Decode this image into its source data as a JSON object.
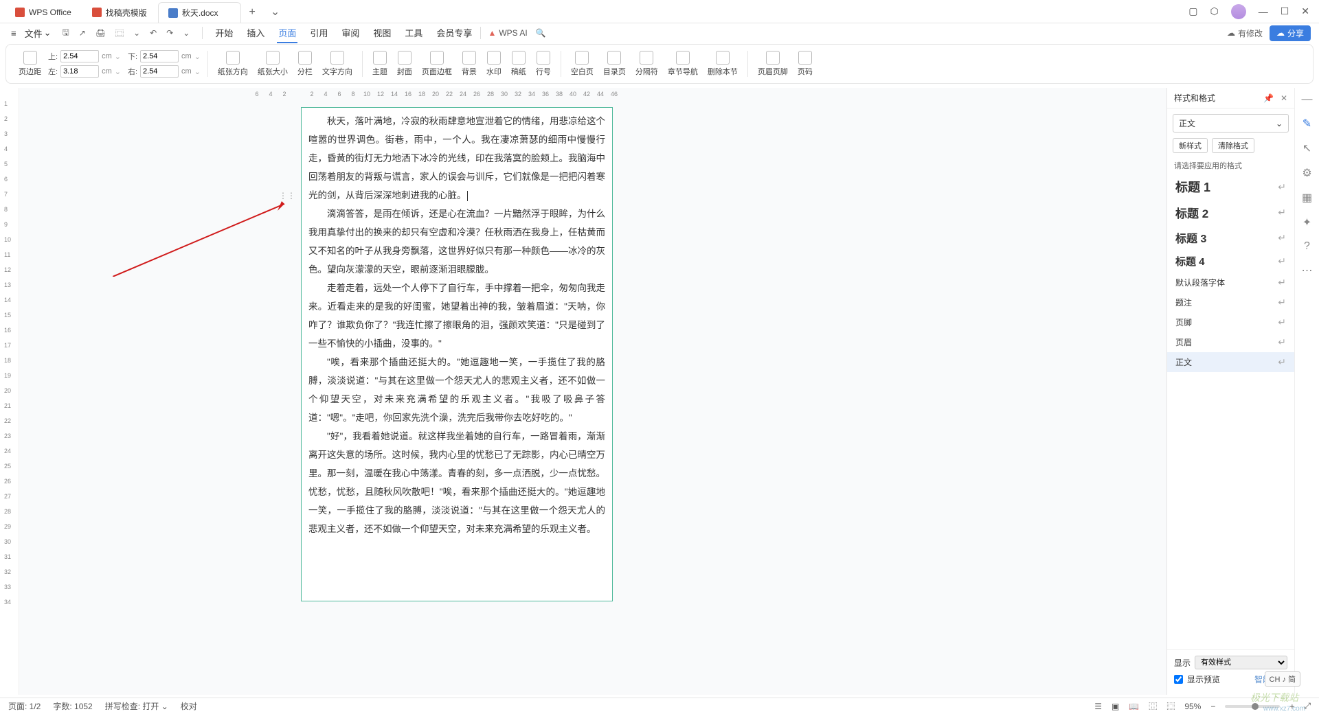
{
  "titlebar": {
    "homeTab": "WPS Office",
    "templateTab": "找稿壳模版",
    "docTab": "秋天.docx",
    "addTab": "+",
    "dropdown": "⌄"
  },
  "wincontrols": {
    "restore": "▢",
    "cube": "⬡",
    "min": "—",
    "max": "☐",
    "close": "✕"
  },
  "menubar": {
    "hamburger": "≡",
    "file": "文件",
    "filedrop": "⌄",
    "menus": [
      "开始",
      "插入",
      "页面",
      "引用",
      "审阅",
      "视图",
      "工具",
      "会员专享"
    ],
    "active": 2,
    "wpsai": "WPS AI",
    "search": "🔍",
    "modified": "有修改",
    "share": "分享"
  },
  "qat": {
    "save": "🖫",
    "export": "↗",
    "print": "🖨",
    "preview": "⿴",
    "undo": "↶",
    "redo": "↷",
    "dd": "⌄"
  },
  "ribbon": {
    "margin": "页边距",
    "top": "上:",
    "topv": "2.54",
    "topu": "cm",
    "bottom": "下:",
    "bottomv": "2.54",
    "bottomu": "cm",
    "left": "左:",
    "leftv": "3.18",
    "leftu": "cm",
    "right": "右:",
    "rightv": "2.54",
    "rightu": "cm",
    "orient": "纸张方向",
    "size": "纸张大小",
    "columns": "分栏",
    "textdir": "文字方向",
    "theme": "主题",
    "cover": "封面",
    "border": "页面边框",
    "bg": "背景",
    "water": "水印",
    "paper": "稿纸",
    "lineno": "行号",
    "blank": "空白页",
    "toc": "目录页",
    "sep": "分隔符",
    "chapnav": "章节导航",
    "delsec": "删除本节",
    "hdrftr": "页眉页脚",
    "pageno": "页码"
  },
  "document": {
    "p1": "秋天，落叶满地，冷寂的秋雨肆意地宣泄着它的情绪，用悲凉给这个喧嚣的世界调色。街巷，雨中，一个人。我在凄凉萧瑟的细雨中慢慢行走，昏黄的街灯无力地洒下冰冷的光线，印在我落寞的脸颊上。我脑海中回荡着朋友的背叛与谎言，家人的误会与训斥，它们就像是一把把闪着寒光的剑，从背后深深地刺进我的心脏。",
    "p2": "滴滴答答，是雨在倾诉，还是心在流血？一片黯然浮于眼眸，为什么我用真挚付出的换来的却只有空虚和冷漠？任秋雨洒在我身上，任枯黄而又不知名的叶子从我身旁飘落，这世界好似只有那一种颜色——冰冷的灰色。望向灰濛濛的天空，眼前逐渐泪眼朦胧。",
    "p3": "走着走着，远处一个人停下了自行车，手中撑着一把伞，匆匆向我走来。近看走来的是我的好闺蜜，她望着出神的我，皱着眉道：\"天呐，你咋了？谁欺负你了？\"我连忙擦了擦眼角的泪，强颜欢笑道：\"只是碰到了一些不愉快的小插曲，没事的。\"",
    "p4": "\"唉，看来那个插曲还挺大的。\"她逗趣地一笑，一手揽住了我的胳膊，淡淡说道：\"与其在这里做一个怨天尤人的悲观主义者，还不如做一个仰望天空，对未来充满希望的乐观主义者。\"我吸了吸鼻子答道：\"嗯\"。\"走吧，你回家先洗个澡，洗完后我带你去吃好吃的。\"",
    "p5": "\"好\"，我看着她说道。就这样我坐着她的自行车，一路冒着雨，渐渐离开这失意的场所。这时候，我内心里的忧愁已了无踪影，内心已晴空万里。那一刻，温暖在我心中荡漾。青春的刻，多一点洒脱，少一点忧愁。忧愁，忧愁，且随秋风吹散吧！\"唉，看来那个插曲还挺大的。\"她逗趣地一笑，一手揽住了我的胳膊，淡淡说道：\"与其在这里做一个怨天尤人的悲观主义者，还不如做一个仰望天空，对未来充满希望的乐观主义者。"
  },
  "hruler": [
    "6",
    "4",
    "2",
    "",
    "2",
    "4",
    "6",
    "8",
    "10",
    "12",
    "14",
    "16",
    "18",
    "20",
    "22",
    "24",
    "26",
    "28",
    "30",
    "32",
    "34",
    "36",
    "38",
    "40",
    "42",
    "44",
    "46"
  ],
  "vruler": [
    "1",
    "2",
    "3",
    "4",
    "5",
    "6",
    "7",
    "8",
    "9",
    "10",
    "11",
    "12",
    "13",
    "14",
    "15",
    "16",
    "17",
    "18",
    "19",
    "20",
    "21",
    "22",
    "23",
    "24",
    "25",
    "26",
    "27",
    "28",
    "29",
    "30",
    "31",
    "32",
    "33",
    "34"
  ],
  "rightpanel": {
    "title": "样式和格式",
    "currentStyle": "正文",
    "btnNew": "新样式",
    "btnClear": "清除格式",
    "labelChoose": "请选择要应用的格式",
    "styles": [
      {
        "name": "标题 1",
        "cls": "h1"
      },
      {
        "name": "标题 2",
        "cls": "h2"
      },
      {
        "name": "标题 3",
        "cls": "h3"
      },
      {
        "name": "标题 4",
        "cls": "h4"
      },
      {
        "name": "默认段落字体",
        "cls": "sm"
      },
      {
        "name": "题注",
        "cls": "sm"
      },
      {
        "name": "页脚",
        "cls": "sm"
      },
      {
        "name": "页眉",
        "cls": "sm"
      },
      {
        "name": "正文",
        "cls": "sm",
        "sel": true
      }
    ],
    "showLabel": "显示",
    "showValue": "有效样式",
    "preview": "显示预览",
    "smart": "智能排版"
  },
  "status": {
    "page": "页面: 1/2",
    "words": "字数: 1052",
    "spell": "拼写检查: 打开",
    "proof": "校对",
    "zoom": "95%",
    "ch": "CH ♪ 简"
  },
  "watermark": "极光下载站",
  "watermark2": "www.xz7.com"
}
